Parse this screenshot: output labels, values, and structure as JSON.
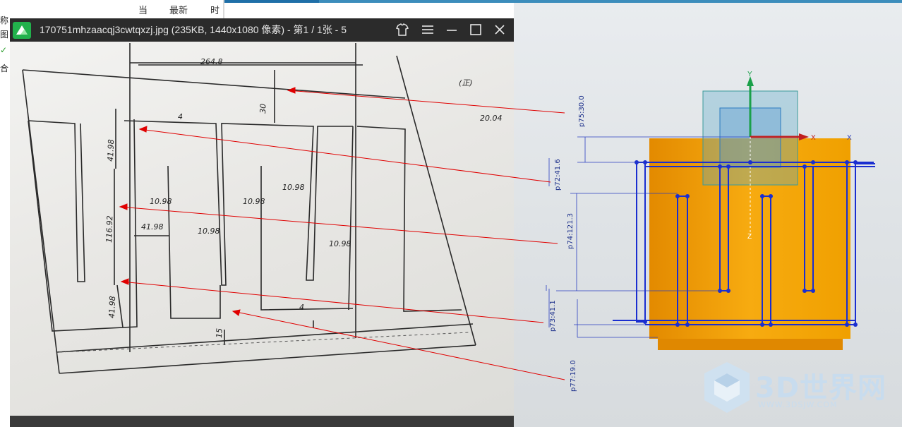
{
  "background_window": {
    "header_items": [
      "当",
      "最新",
      "时"
    ],
    "side_chars": [
      "称",
      "图",
      "✓",
      "合"
    ]
  },
  "viewer": {
    "title": "170751mhzaacqj3cwtqxzj.jpg (235KB, 1440x1080 像素) - 第1 / 1张 - 5"
  },
  "photo_notes": {
    "top_dim": "264.8",
    "dim_30": "30",
    "dim_4_top": "4",
    "dim_41_98_top": "41.98",
    "dim_10_98_a": "10.98",
    "dim_10_98_b": "10.98",
    "dim_10_98_c": "10.98",
    "dim_10_98_d": "10.98",
    "dim_10_98_e": "10.98",
    "dim_116_92": "116.92",
    "dim_41_98_mid": "41.98",
    "dim_41_98_bot": "41.98",
    "dim_4_bot": "4",
    "dim_15": "15",
    "corner_note": "(正)",
    "corner_note2": "20.04"
  },
  "cad": {
    "axis_y": "Y",
    "axis_x": "X",
    "axis_z": "Z",
    "dims": [
      "p75:30.0",
      "p72:41.6",
      "p74:121.3",
      "p73:41.1",
      "p77:19.0"
    ],
    "colors": {
      "body": "#f0a000",
      "wire": "#1a2ed0",
      "arrow": "#e00000"
    }
  },
  "watermark": {
    "brand": "3D世界网",
    "url": "WWW.3DSJW.COM"
  }
}
